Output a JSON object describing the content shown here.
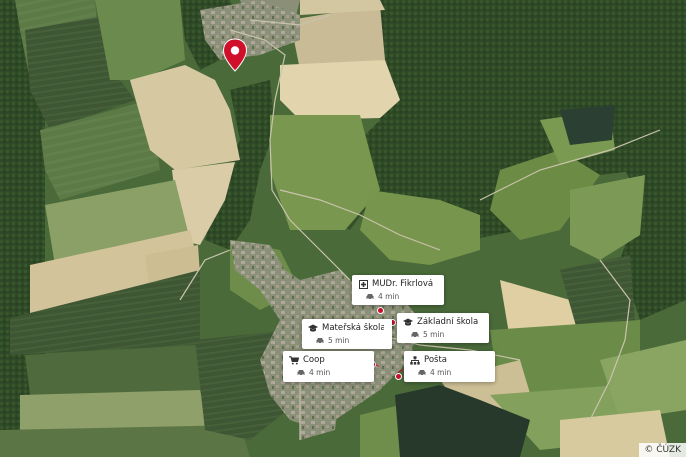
{
  "map": {
    "type": "aerial-photo",
    "attribution": "© ČÚZK"
  },
  "pois": [
    {
      "name": "MUDr. Fikrlová Š...",
      "time": "4 min",
      "icon": "medical-cross-icon"
    },
    {
      "name": "Mateřská škola M...",
      "time": "5 min",
      "icon": "graduation-cap-icon"
    },
    {
      "name": "Základní škola M...",
      "time": "5 min",
      "icon": "graduation-cap-icon"
    },
    {
      "name": "Coop",
      "time": "4 min",
      "icon": "shopping-cart-icon"
    },
    {
      "name": "Pošta",
      "time": "4 min",
      "icon": "post-office-icon"
    }
  ],
  "colors": {
    "pin": "#d0102a",
    "connector": "#c8102e"
  }
}
